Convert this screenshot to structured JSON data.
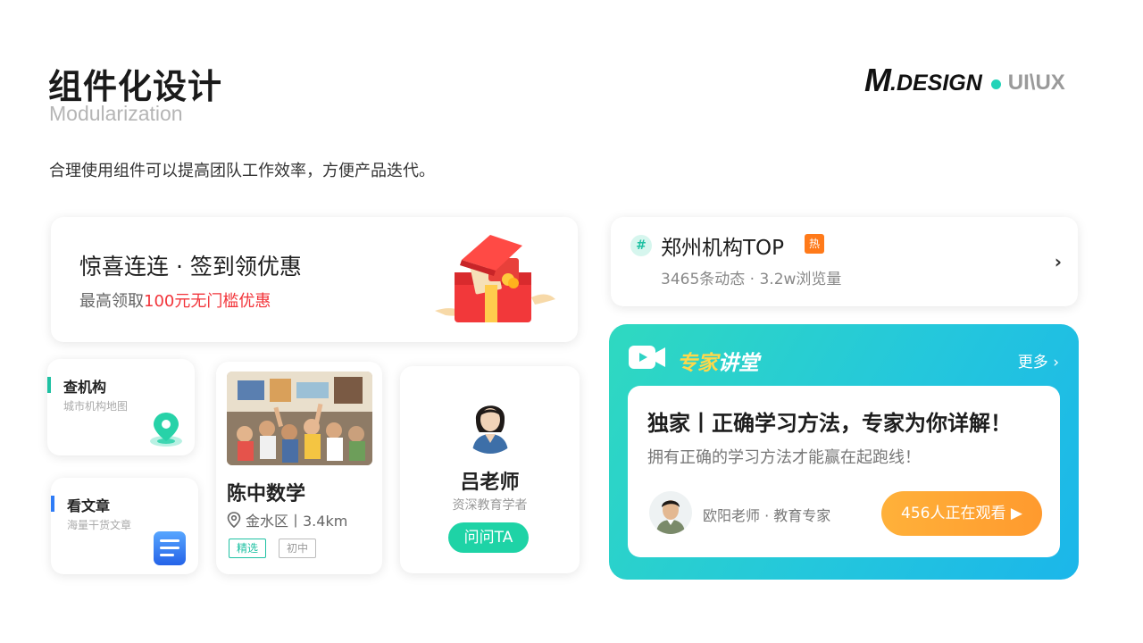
{
  "header": {
    "title": "组件化设计",
    "subtitle": "Modularization",
    "description": "合理使用组件可以提高团队工作效率，方便产品迭代。"
  },
  "brand": {
    "m": "M",
    "design": ".DESIGN",
    "uiux": "UI\\UX",
    "dot_color": "#22d3b8"
  },
  "checkin": {
    "title": "惊喜连连 · 签到领优惠",
    "sub_prefix": "最高领取",
    "sub_highlight": "100元无门槛优惠"
  },
  "tiles": [
    {
      "title": "查机构",
      "sub": "城市机构地图",
      "accent": "#1fc1a3",
      "icon": "map-pin-icon"
    },
    {
      "title": "看文章",
      "sub": "海量干货文章",
      "accent": "#2f7cf6",
      "icon": "article-list-icon"
    }
  ],
  "school": {
    "name": "陈中数学",
    "location": "金水区丨3.4km",
    "tags": [
      "精选",
      "初中"
    ]
  },
  "teacher": {
    "name": "吕老师",
    "role": "资深教育学者",
    "button": "问问TA"
  },
  "topic": {
    "hash": "#",
    "title": "郑州机构TOP",
    "hot": "热",
    "stats": "3465条动态 · 3.2w浏览量",
    "arrow": "›"
  },
  "expert": {
    "title_yellow": "专家",
    "title_white": "讲堂",
    "more": "更多 ›",
    "headline": "独家丨正确学习方法，专家为你详解！",
    "sub": "拥有正确的学习方法才能赢在起跑线！",
    "lecturer": "欧阳老师 · 教育专家",
    "watch_button": "456人正在观看 ▶"
  }
}
